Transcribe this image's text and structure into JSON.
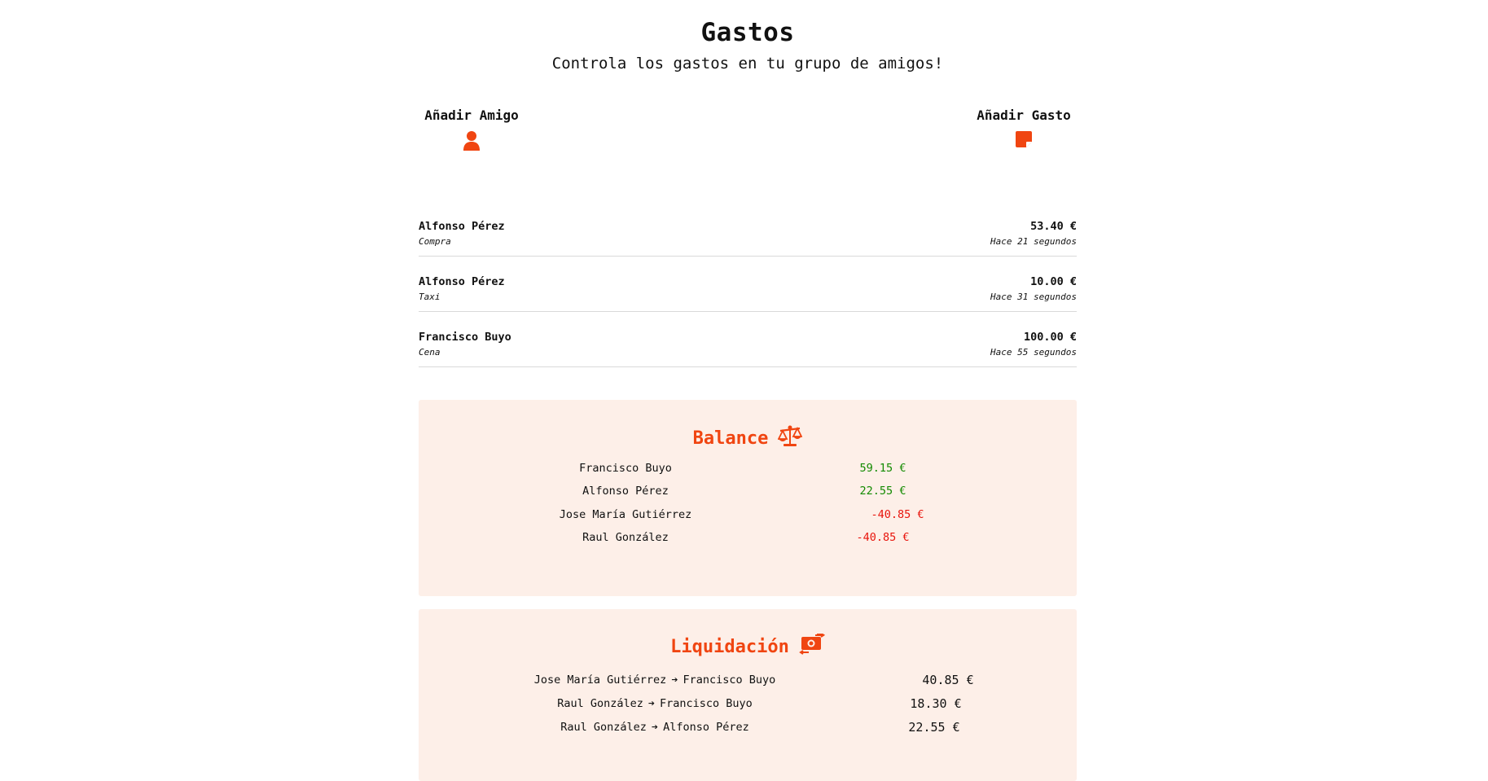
{
  "header": {
    "title": "Gastos",
    "subtitle": "Controla los gastos en tu grupo de amigos!"
  },
  "actions": {
    "add_friend_label": "Añadir Amigo",
    "add_friend_icon": "user-icon",
    "add_expense_label": "Añadir Gasto",
    "add_expense_icon": "sticky-note-icon"
  },
  "expenses": [
    {
      "name": "Alfonso Pérez",
      "description": "Compra",
      "amount": "53.40 €",
      "time": "Hace 21 segundos"
    },
    {
      "name": "Alfonso Pérez",
      "description": "Taxi",
      "amount": "10.00 €",
      "time": "Hace 31 segundos"
    },
    {
      "name": "Francisco Buyo",
      "description": "Cena",
      "amount": "100.00 €",
      "time": "Hace 55 segundos"
    }
  ],
  "balance": {
    "title": "Balance",
    "icon": "scale-balanced-icon",
    "rows": [
      {
        "name": "Francisco Buyo",
        "amount": "59.15 €",
        "status": "positive"
      },
      {
        "name": "Alfonso Pérez",
        "amount": "22.55 €",
        "status": "positive"
      },
      {
        "name": "Jose María Gutiérrez",
        "amount": "-40.85 €",
        "status": "negative"
      },
      {
        "name": "Raul González",
        "amount": "-40.85 €",
        "status": "negative"
      }
    ]
  },
  "liquidacion": {
    "title": "Liquidación",
    "icon": "money-bill-transfer-icon",
    "rows": [
      {
        "from": "Jose María Gutiérrez",
        "to": "Francisco Buyo",
        "amount": "40.85 €"
      },
      {
        "from": "Raul González",
        "to": "Francisco Buyo",
        "amount": "18.30 €"
      },
      {
        "from": "Raul González",
        "to": "Alfonso Pérez",
        "amount": "22.55 €"
      }
    ]
  },
  "colors": {
    "accent": "#f04511",
    "panel_bg": "#fdefe8",
    "positive": "#138a00",
    "negative": "#e8140c",
    "text": "#111111"
  }
}
